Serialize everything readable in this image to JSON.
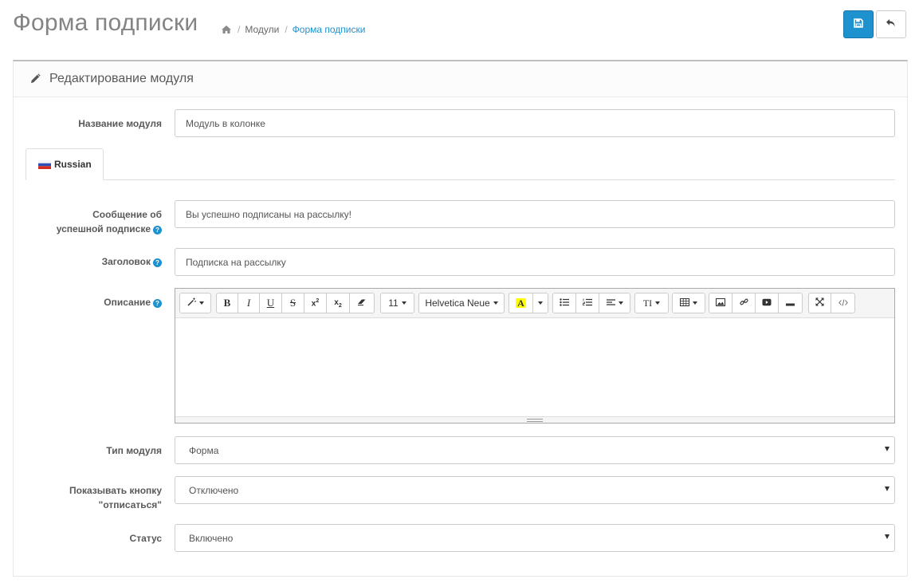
{
  "page": {
    "title": "Форма подписки"
  },
  "breadcrumb": {
    "home_icon": "home-icon",
    "items": [
      "Модули",
      "Форма подписки"
    ]
  },
  "header_buttons": {
    "save_icon": "save-icon",
    "back_icon": "reply-icon",
    "accent": "#1e91cf"
  },
  "panel": {
    "heading_icon": "pencil-icon",
    "heading": "Редактирование модуля"
  },
  "form": {
    "name": {
      "label": "Название модуля",
      "value": "Модуль в колонке"
    },
    "language_tab": {
      "label": "Russian",
      "flag": "russia-flag-icon"
    },
    "success_message": {
      "label_line1": "Сообщение об",
      "label_line2": "успешной подписке",
      "value": "Вы успешно подписаны на рассылку!"
    },
    "heading": {
      "label": "Заголовок",
      "value": "Подписка на рассылку"
    },
    "description": {
      "label": "Описание",
      "value": ""
    },
    "module_type": {
      "label": "Тип модуля",
      "value": "Форма"
    },
    "unsubscribe": {
      "label_line1": "Показывать кнопку",
      "label_line2": "\"отписаться\"",
      "value": "Отключено"
    },
    "status": {
      "label": "Статус",
      "value": "Включено"
    }
  },
  "editor_toolbar": {
    "font_size": "11",
    "font_family": "Helvetica Neue",
    "bold": "B",
    "italic": "I",
    "underline": "U",
    "strike": "S",
    "color_letter": "A",
    "highlight_color": "#ffff00"
  }
}
